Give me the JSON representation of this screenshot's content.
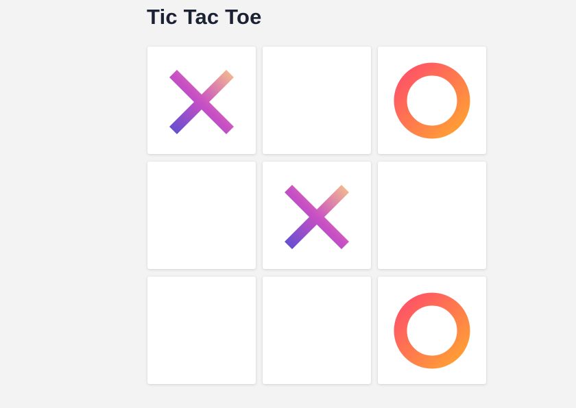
{
  "title": "Tic Tac Toe",
  "board": [
    "X",
    "",
    "O",
    "",
    "X",
    "",
    "",
    "",
    "O"
  ],
  "colors": {
    "background": "#f3f3f3",
    "title": "#1b2233",
    "cell": "#ffffff",
    "x_gradient": [
      "#f6c48a",
      "#c84fc4",
      "#5a4fd0"
    ],
    "o_gradient": [
      "#ff4f6a",
      "#ffa332"
    ]
  },
  "icons": {
    "X": "x-mark-icon",
    "O": "o-mark-icon"
  }
}
